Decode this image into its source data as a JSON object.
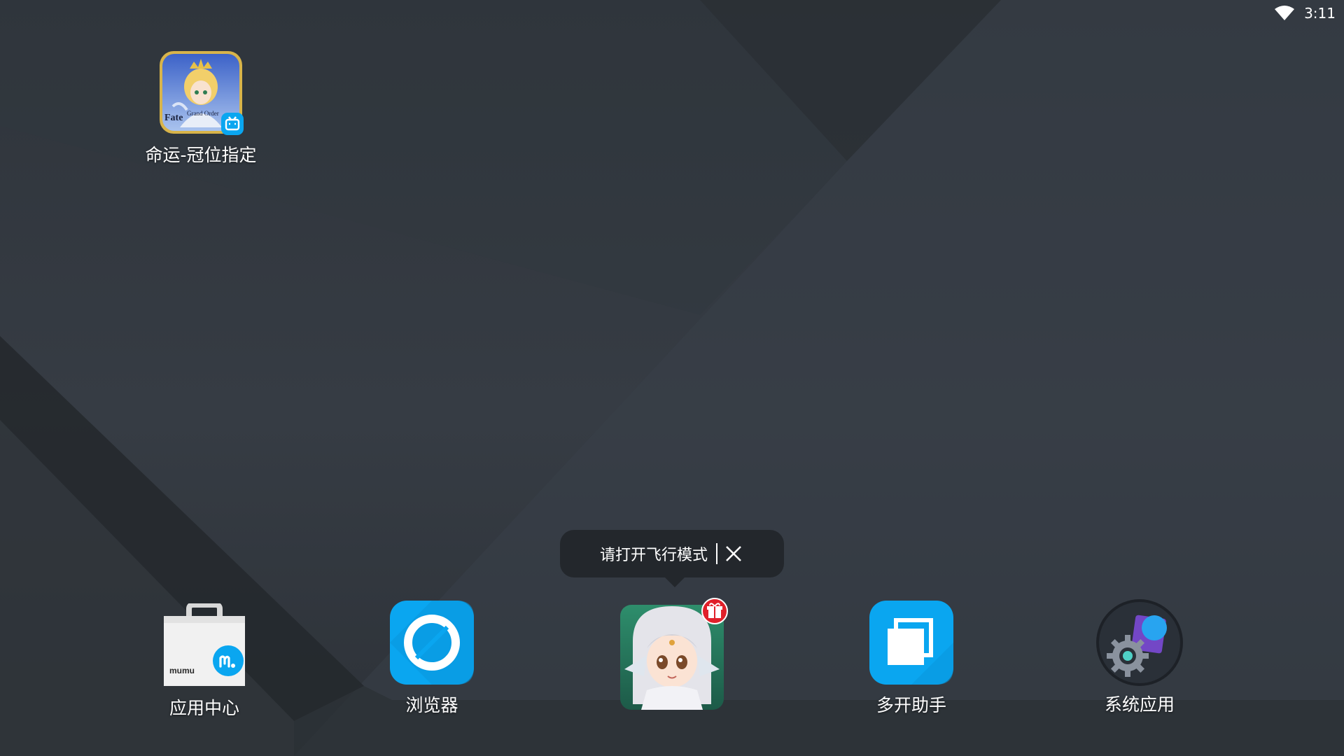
{
  "status_bar": {
    "time": "3:11",
    "wifi_icon": "wifi-icon"
  },
  "desktop": {
    "apps": [
      {
        "label": "命运-冠位指定",
        "icon": "fate-grand-order-icon",
        "badge_icon": "bilibili-badge-icon",
        "icon_text_1": "Fate",
        "icon_text_2": "Grand Order"
      }
    ]
  },
  "dock": {
    "apps": [
      {
        "label": "应用中心",
        "icon": "app-center-bag-icon",
        "icon_text": "mumu"
      },
      {
        "label": "浏览器",
        "icon": "browser-icon"
      },
      {
        "label": "",
        "icon": "game-character-icon",
        "badge_icon": "gift-badge-icon"
      },
      {
        "label": "多开助手",
        "icon": "multi-open-icon"
      },
      {
        "label": "系统应用",
        "icon": "system-settings-icon"
      }
    ]
  },
  "tooltip": {
    "text": "请打开飞行模式",
    "close_icon": "close-icon"
  },
  "colors": {
    "accent_blue": "#0aa6f0",
    "background": "#2e333a",
    "tooltip_bg": "#23272c",
    "gift_red": "#e0202a"
  }
}
